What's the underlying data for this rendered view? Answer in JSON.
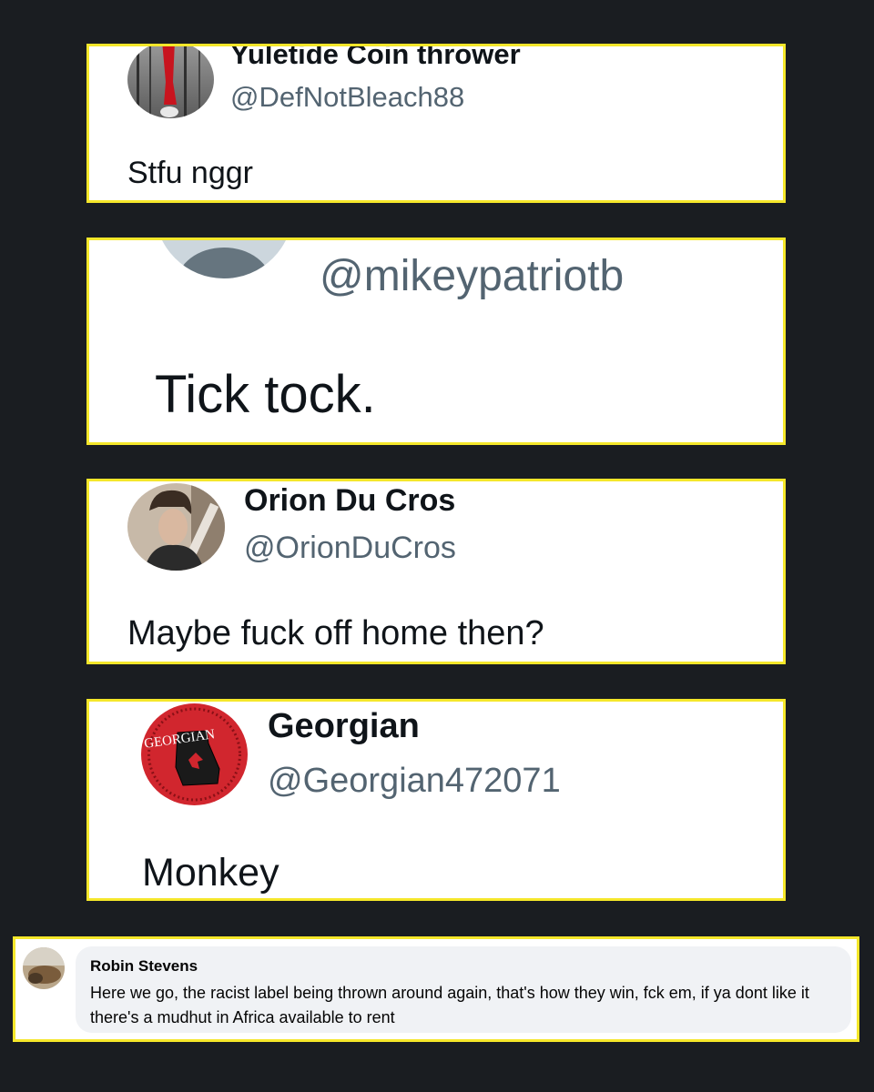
{
  "tweets": [
    {
      "name": "Yuletide Coin thrower",
      "handle": "@DefNotBleach88",
      "text": "Stfu nggr"
    },
    {
      "name": "",
      "handle": "@mikeypatriotb",
      "text": "Tick tock."
    },
    {
      "name": "Orion Du Cros",
      "handle": "@OrionDuCros",
      "text": "Maybe fuck off home then?"
    },
    {
      "name": "Georgian",
      "handle": "@Georgian472071",
      "text": "Monkey",
      "avatar_text": "GEORGIAN"
    }
  ],
  "facebook_comment": {
    "name": "Robin Stevens",
    "text": "Here we go, the racist label being thrown around again, that's how they win, fck em, if ya dont like it there's a mudhut in Africa available to rent"
  },
  "colors": {
    "highlight_border": "#f5e72a",
    "background": "#1a1d21",
    "handle_gray": "#536471"
  }
}
